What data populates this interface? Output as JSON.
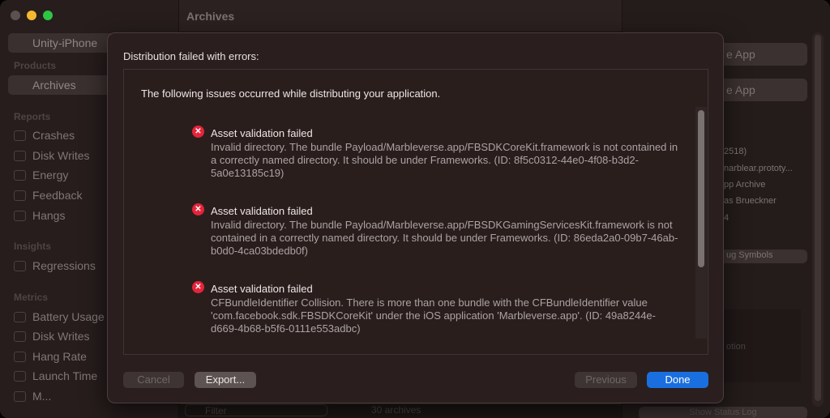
{
  "sidebar": {
    "scheme": "Unity-iPhone",
    "products": "Products",
    "archives": "Archives",
    "reports": "Reports",
    "report_items": [
      "Crashes",
      "Disk Writes",
      "Energy",
      "Feedback",
      "Hangs"
    ],
    "insights": "Insights",
    "insight_items": [
      "Regressions"
    ],
    "metrics": "Metrics",
    "metric_items": [
      "Battery Usage",
      "Disk Writes",
      "Hang Rate",
      "Launch Time",
      "M..."
    ]
  },
  "main": {
    "title": "Archives",
    "filter_placeholder": "Filter",
    "count": "30 archives"
  },
  "right": {
    "btn1": "e App",
    "btn2": "e App",
    "lines": [
      "2518)",
      "narblear.prototy...",
      "pp Archive",
      "as Brueckner",
      "4"
    ],
    "debug": "ug Symbols",
    "desc": "otion",
    "status_log": "Show Status Log"
  },
  "dialog": {
    "title": "Distribution failed with errors:",
    "header": "The following issues occurred while distributing your application.",
    "issues": [
      {
        "title": "Asset validation failed",
        "body": "Invalid directory. The bundle Payload/Marbleverse.app/FBSDKCoreKit.framework is not contained in a correctly named directory. It should be under Frameworks. (ID: 8f5c0312-44e0-4f08-b3d2-5a0e13185c19)"
      },
      {
        "title": "Asset validation failed",
        "body": "Invalid directory. The bundle Payload/Marbleverse.app/FBSDKGamingServicesKit.framework is not contained in a correctly named directory. It should be under Frameworks. (ID: 86eda2a0-09b7-46ab-b0d0-4ca03bdedb0f)"
      },
      {
        "title": "Asset validation failed",
        "body": "CFBundleIdentifier Collision. There is more than one bundle with the CFBundleIdentifier value 'com.facebook.sdk.FBSDKCoreKit' under the iOS application 'Marbleverse.app'. (ID: 49a8244e-d669-4b68-b5f6-0111e553adbc)"
      }
    ],
    "cancel": "Cancel",
    "export": "Export...",
    "previous": "Previous",
    "done": "Done"
  },
  "colors": {
    "accent": "#1a6fe0",
    "error": "#e5243a"
  }
}
